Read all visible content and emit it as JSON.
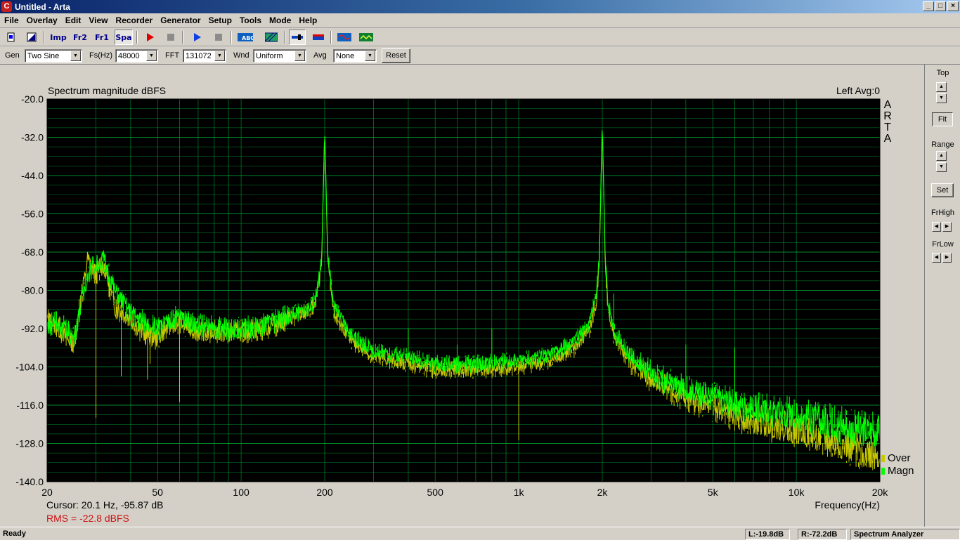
{
  "window": {
    "title": "Untitled - Arta",
    "min_label": "_",
    "max_label": "□",
    "close_label": "×"
  },
  "menu": [
    "File",
    "Overlay",
    "Edit",
    "View",
    "Recorder",
    "Generator",
    "Setup",
    "Tools",
    "Mode",
    "Help"
  ],
  "toolbar": {
    "buttons": [
      {
        "name": "new-icon"
      },
      {
        "name": "open-icon"
      },
      {
        "name": "imp-mode-icon",
        "label": "Imp"
      },
      {
        "name": "fr2-mode-icon",
        "label": "Fr2"
      },
      {
        "name": "fr1-mode-icon",
        "label": "Fr1"
      },
      {
        "name": "spa-mode-icon",
        "label": "Spa",
        "pressed": true
      },
      {
        "name": "record-icon"
      },
      {
        "name": "stop-record-icon"
      },
      {
        "name": "play-icon"
      },
      {
        "name": "stop-play-icon"
      },
      {
        "name": "overlay-abc-icon",
        "label": "ABC"
      },
      {
        "name": "hatch-icon"
      },
      {
        "name": "meter-icon"
      },
      {
        "name": "spectrum-bar-icon"
      },
      {
        "name": "generator-scope-icon"
      },
      {
        "name": "scope-icon"
      }
    ]
  },
  "controls": {
    "gen_label": "Gen",
    "gen_value": "Two Sine",
    "fs_label": "Fs(Hz)",
    "fs_value": "48000",
    "fft_label": "FFT",
    "fft_value": "131072",
    "wnd_label": "Wnd",
    "wnd_value": "Uniform",
    "avg_label": "Avg",
    "avg_value": "None",
    "reset_label": "Reset"
  },
  "chart_data": {
    "type": "line",
    "title": "Spectrum magnitude dBFS",
    "channel_info": "Left  Avg:0",
    "watermark": [
      "A",
      "R",
      "T",
      "A"
    ],
    "xlabel": "Frequency(Hz)",
    "x_scale": "log",
    "xlim": [
      20,
      20000
    ],
    "ylim": [
      -140,
      -20
    ],
    "ytick_values": [
      -20,
      -32,
      -44,
      -56,
      -68,
      -80,
      -92,
      -104,
      -116,
      -128,
      -140
    ],
    "ytick_labels": [
      "-20.0",
      "-32.0",
      "-44.0",
      "-56.0",
      "-68.0",
      "-80.0",
      "-92.0",
      "-104.0",
      "-116.0",
      "-128.0",
      "-140.0"
    ],
    "xtick_values": [
      20,
      50,
      100,
      200,
      500,
      1000,
      2000,
      5000,
      10000,
      20000
    ],
    "xtick_labels": [
      "20",
      "50",
      "100",
      "200",
      "500",
      "1k",
      "2k",
      "5k",
      "10k",
      "20k"
    ],
    "grid": true,
    "background": "#000000",
    "grid_color": "#008a2e",
    "legend": [
      {
        "name": "Over",
        "color": "#c8c800"
      },
      {
        "name": "Magn",
        "color": "#00ff00"
      }
    ],
    "series": [
      {
        "name": "Magn",
        "color": "#00ff00",
        "x": [
          20,
          22,
          25,
          28,
          30,
          32,
          35,
          40,
          45,
          50,
          55,
          60,
          70,
          80,
          100,
          120,
          150,
          170,
          185,
          195,
          200,
          205,
          215,
          250,
          300,
          400,
          500,
          700,
          1000,
          1300,
          1600,
          1800,
          1900,
          1950,
          2000,
          2050,
          2100,
          2200,
          2500,
          3000,
          4000,
          5000,
          7000,
          10000,
          14000,
          17000,
          20000
        ],
        "y": [
          -91,
          -90,
          -95,
          -75,
          -72,
          -70,
          -80,
          -87,
          -90,
          -92,
          -90,
          -88,
          -91,
          -92,
          -92,
          -91,
          -88,
          -86,
          -83,
          -70,
          -29,
          -68,
          -85,
          -94,
          -99,
          -101,
          -103,
          -103,
          -102,
          -100,
          -96,
          -90,
          -82,
          -70,
          -27,
          -70,
          -84,
          -93,
          -100,
          -106,
          -111,
          -113,
          -117,
          -119,
          -122,
          -124,
          -124
        ]
      },
      {
        "name": "Over",
        "color": "#c8c800",
        "x": [
          20,
          22,
          25,
          28,
          30,
          32,
          35,
          40,
          45,
          50,
          55,
          60,
          70,
          80,
          100,
          120,
          150,
          170,
          185,
          195,
          200,
          205,
          215,
          250,
          300,
          400,
          500,
          700,
          1000,
          1300,
          1600,
          1800,
          1900,
          1950,
          2000,
          2050,
          2100,
          2200,
          2500,
          3000,
          4000,
          5000,
          7000,
          10000,
          14000,
          17000,
          20000
        ],
        "y": [
          -89,
          -92,
          -97,
          -70,
          -75,
          -72,
          -85,
          -89,
          -94,
          -95,
          -91,
          -90,
          -93,
          -93,
          -93,
          -92,
          -89,
          -87,
          -84,
          -72,
          -30,
          -70,
          -87,
          -96,
          -101,
          -103,
          -105,
          -105,
          -104,
          -102,
          -98,
          -92,
          -84,
          -72,
          -28,
          -72,
          -86,
          -95,
          -102,
          -108,
          -114,
          -117,
          -121,
          -124,
          -128,
          -130,
          -132
        ]
      }
    ],
    "spurs": [
      {
        "x": 30,
        "y": -120
      },
      {
        "x": 37,
        "y": -107
      },
      {
        "x": 46,
        "y": -108
      },
      {
        "x": 47,
        "y": -103
      },
      {
        "x": 60,
        "y": -115
      },
      {
        "x": 400,
        "y": -92
      },
      {
        "x": 600,
        "y": -97
      },
      {
        "x": 800,
        "y": -92
      },
      {
        "x": 1000,
        "y": -127
      },
      {
        "x": 1800,
        "y": -88
      },
      {
        "x": 2200,
        "y": -81
      },
      {
        "x": 4000,
        "y": -97
      },
      {
        "x": 6000,
        "y": -98
      }
    ],
    "cursor": "Cursor:    20.1 Hz, -95.87 dB",
    "rms": "RMS =  -22.8 dBFS"
  },
  "side_panel": {
    "top_label": "Top",
    "fit_label": "Fit",
    "range_label": "Range",
    "set_label": "Set",
    "frhigh_label": "FrHigh",
    "frlow_label": "FrLow"
  },
  "status": {
    "ready": "Ready",
    "left_level": "L:-19.8dB",
    "right_level": "R:-72.2dB",
    "mode": "Spectrum Analyzer"
  }
}
